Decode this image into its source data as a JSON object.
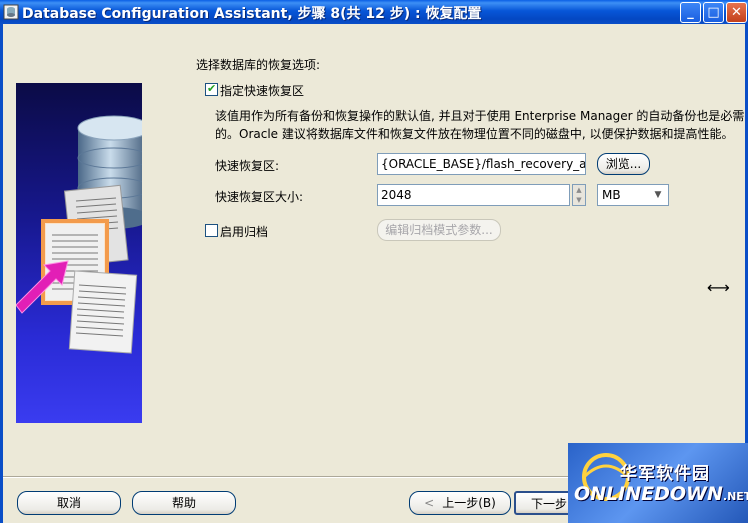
{
  "window": {
    "title": "Database Configuration Assistant, 步骤 8(共 12 步) : 恢复配置",
    "controls": {
      "minimize": "_",
      "maximize": "□",
      "close": "✕"
    }
  },
  "panel": {
    "heading": "选择数据库的恢复选项:",
    "fast_recovery": {
      "checkbox_label": "指定快速恢复区",
      "checked": true,
      "description_line1": "该值用作为所有备份和恢复操作的默认值, 并且对于使用 Enterprise Manager 的自动备份也是必需",
      "description_line2": "的。Oracle 建议将数据库文件和恢复文件放在物理位置不同的磁盘中, 以便保护数据和提高性能。",
      "area_label": "快速恢复区:",
      "area_value": "{ORACLE_BASE}/flash_recovery_area",
      "browse_button": "浏览...",
      "size_label": "快速恢复区大小:",
      "size_value": "2048",
      "size_unit": "MB"
    },
    "archive": {
      "checkbox_label": "启用归档",
      "checked": false,
      "edit_params_button": "编辑归档模式参数..."
    }
  },
  "footer": {
    "cancel_button": "取消",
    "help_button": "帮助",
    "back_button": "上一步(B)",
    "next_button": "下一步"
  },
  "watermark": {
    "cn_text": "华军软件园",
    "en_text": "ONLINEDOWN",
    "suffix": ".NET"
  },
  "icons": {
    "app": "dbca-app-icon",
    "resize_cursor": "horizontal-resize-cursor-icon"
  }
}
